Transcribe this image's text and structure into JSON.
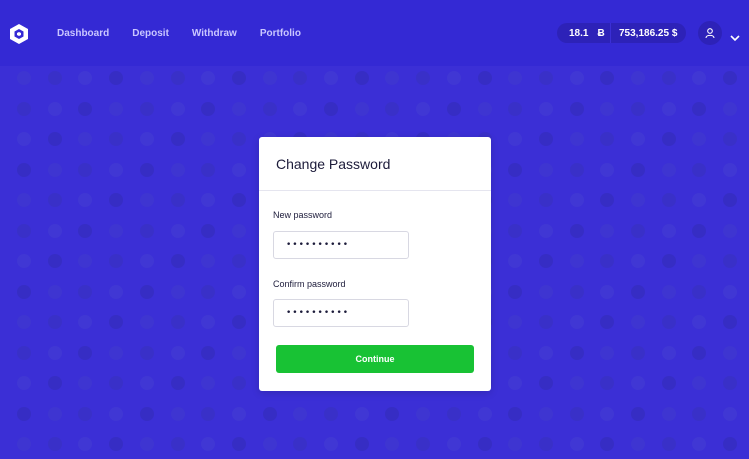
{
  "nav": {
    "items": [
      {
        "label": "Dashboard"
      },
      {
        "label": "Deposit"
      },
      {
        "label": "Withdraw"
      },
      {
        "label": "Portfolio"
      }
    ]
  },
  "balance": {
    "btc_amount": "18.1",
    "btc_symbol": "Ƀ",
    "usd_amount": "753,186.25 $"
  },
  "icons": {
    "logo": "logo-icon",
    "user": "user-icon",
    "chevron": "chevron-down-icon"
  },
  "modal": {
    "title": "Change Password",
    "new_password_label": "New password",
    "new_password_value": "••••••••••",
    "confirm_password_label": "Confirm password",
    "confirm_password_value": "••••••••••",
    "continue_label": "Continue"
  },
  "colors": {
    "background": "#3b2fd6",
    "topbar": "#3429d4",
    "accent_green": "#18c234",
    "pill": "#2d22b8"
  }
}
